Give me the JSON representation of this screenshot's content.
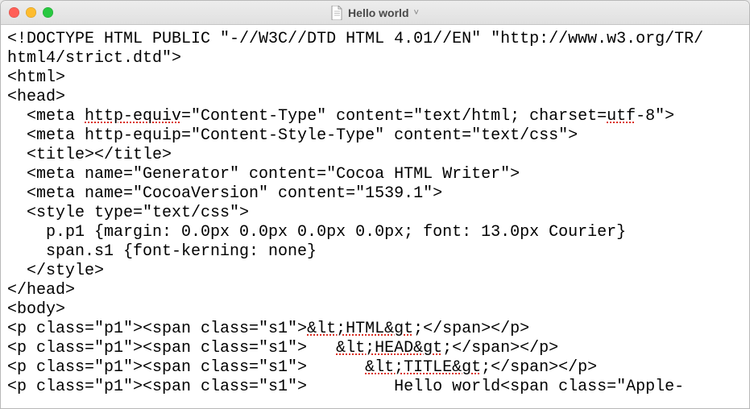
{
  "window": {
    "title": "Hello world",
    "doc_icon": "document-icon",
    "dropdown_glyph": "˅"
  },
  "code": {
    "lines": [
      {
        "segments": [
          {
            "t": "<!DOCTYPE HTML PUBLIC \"-//W3C//DTD HTML 4.01//EN\" \"http://www.w3.org/TR/"
          }
        ]
      },
      {
        "segments": [
          {
            "t": "html4/strict.dtd\">"
          }
        ]
      },
      {
        "segments": [
          {
            "t": "<html>"
          }
        ]
      },
      {
        "segments": [
          {
            "t": "<head>"
          }
        ]
      },
      {
        "segments": [
          {
            "t": "  <meta "
          },
          {
            "t": "http-equiv",
            "err": true
          },
          {
            "t": "=\"Content-Type\" content=\"text/html; charset="
          },
          {
            "t": "utf",
            "err": true
          },
          {
            "t": "-8\">"
          }
        ]
      },
      {
        "segments": [
          {
            "t": "  <meta http-equip=\"Content-Style-Type\" content=\"text/css\">"
          }
        ]
      },
      {
        "segments": [
          {
            "t": "  <title></title>"
          }
        ]
      },
      {
        "segments": [
          {
            "t": "  <meta name=\"Generator\" content=\"Cocoa HTML Writer\">"
          }
        ]
      },
      {
        "segments": [
          {
            "t": "  <meta name=\"CocoaVersion\" content=\"1539.1\">"
          }
        ]
      },
      {
        "segments": [
          {
            "t": "  <style type=\"text/css\">"
          }
        ]
      },
      {
        "segments": [
          {
            "t": "    p.p1 {margin: 0.0px 0.0px 0.0px 0.0px; font: 13.0px Courier}"
          }
        ]
      },
      {
        "segments": [
          {
            "t": "    span.s1 {font-kerning: none}"
          }
        ]
      },
      {
        "segments": [
          {
            "t": "  </style>"
          }
        ]
      },
      {
        "segments": [
          {
            "t": "</head>"
          }
        ]
      },
      {
        "segments": [
          {
            "t": "<body>"
          }
        ]
      },
      {
        "segments": [
          {
            "t": "<p class=\"p1\"><span class=\"s1\">"
          },
          {
            "t": "&lt;HTML&gt",
            "err": true
          },
          {
            "t": ";</span></p>"
          }
        ]
      },
      {
        "segments": [
          {
            "t": "<p class=\"p1\"><span class=\"s1\">   "
          },
          {
            "t": "&lt;HEAD&gt",
            "err": true
          },
          {
            "t": ";</span></p>"
          }
        ]
      },
      {
        "segments": [
          {
            "t": "<p class=\"p1\"><span class=\"s1\">      "
          },
          {
            "t": "&lt;TITLE&gt",
            "err": true
          },
          {
            "t": ";</span></p>"
          }
        ]
      },
      {
        "segments": [
          {
            "t": "<p class=\"p1\"><span class=\"s1\">         Hello world<span class=\"Apple-"
          }
        ]
      }
    ]
  }
}
